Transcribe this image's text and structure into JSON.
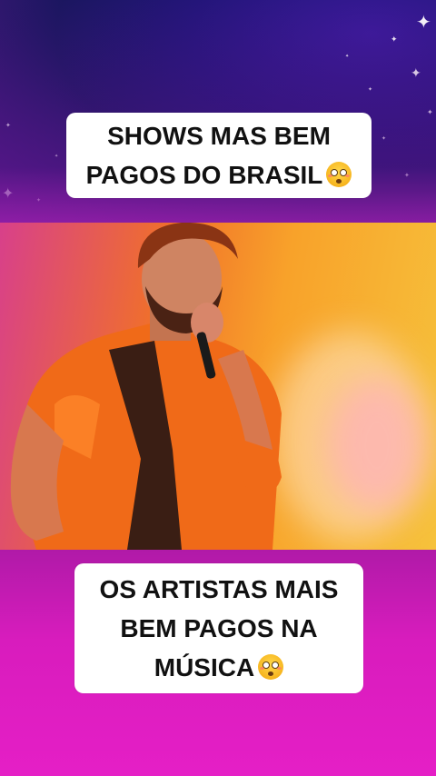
{
  "top_caption": {
    "line1": "SHOWS MAS BEM",
    "line2": "PAGOS DO BRASIL",
    "emoji": "flushed-face-emoji"
  },
  "bottom_caption": {
    "line1": "OS ARTISTAS MAIS",
    "line2": "BEM PAGOS NA",
    "line3": "MÚSICA",
    "emoji": "flushed-face-emoji"
  },
  "photo": {
    "subject": "singer-with-microphone",
    "shirt_color": "#ff6a1c"
  },
  "colors": {
    "top_background": "#24157a",
    "bottom_background": "#d81cbd",
    "caption_background": "#ffffff",
    "caption_text": "#111111"
  }
}
